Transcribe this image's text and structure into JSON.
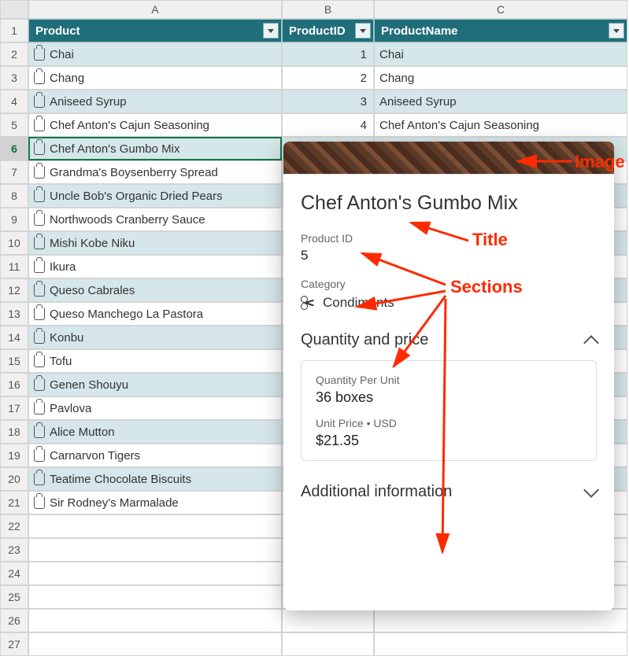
{
  "columns": {
    "a": "A",
    "b": "B",
    "c": "C"
  },
  "headers": {
    "product": "Product",
    "productId": "ProductID",
    "productName": "ProductName"
  },
  "rows": [
    {
      "n": 2,
      "product": "Chai",
      "id": "1",
      "name": "Chai",
      "band": true
    },
    {
      "n": 3,
      "product": "Chang",
      "id": "2",
      "name": "Chang",
      "band": false
    },
    {
      "n": 4,
      "product": "Aniseed Syrup",
      "id": "3",
      "name": "Aniseed Syrup",
      "band": true
    },
    {
      "n": 5,
      "product": "Chef Anton's Cajun Seasoning",
      "id": "4",
      "name": "Chef Anton's Cajun Seasoning",
      "band": false
    },
    {
      "n": 6,
      "product": "Chef Anton's Gumbo Mix",
      "id": "",
      "name": "",
      "band": true,
      "selected": true
    },
    {
      "n": 7,
      "product": "Grandma's Boysenberry Spread",
      "id": "",
      "name": "",
      "band": false
    },
    {
      "n": 8,
      "product": "Uncle Bob's Organic Dried Pears",
      "id": "",
      "name": "",
      "band": true
    },
    {
      "n": 9,
      "product": "Northwoods Cranberry Sauce",
      "id": "",
      "name": "",
      "band": false
    },
    {
      "n": 10,
      "product": "Mishi Kobe Niku",
      "id": "",
      "name": "",
      "band": true
    },
    {
      "n": 11,
      "product": "Ikura",
      "id": "",
      "name": "",
      "band": false
    },
    {
      "n": 12,
      "product": "Queso Cabrales",
      "id": "",
      "name": "",
      "band": true
    },
    {
      "n": 13,
      "product": "Queso Manchego La Pastora",
      "id": "",
      "name": "",
      "band": false
    },
    {
      "n": 14,
      "product": "Konbu",
      "id": "",
      "name": "",
      "band": true
    },
    {
      "n": 15,
      "product": "Tofu",
      "id": "",
      "name": "",
      "band": false
    },
    {
      "n": 16,
      "product": "Genen Shouyu",
      "id": "",
      "name": "",
      "band": true
    },
    {
      "n": 17,
      "product": "Pavlova",
      "id": "",
      "name": "",
      "band": false
    },
    {
      "n": 18,
      "product": "Alice Mutton",
      "id": "",
      "name": "",
      "band": true
    },
    {
      "n": 19,
      "product": "Carnarvon Tigers",
      "id": "",
      "name": "",
      "band": false
    },
    {
      "n": 20,
      "product": "Teatime Chocolate Biscuits",
      "id": "",
      "name": "",
      "band": true
    },
    {
      "n": 21,
      "product": "Sir Rodney's Marmalade",
      "id": "",
      "name": "",
      "band": false
    }
  ],
  "emptyRows": [
    22,
    23,
    24,
    25,
    26,
    27
  ],
  "card": {
    "title": "Chef Anton's Gumbo Mix",
    "productIdLabel": "Product ID",
    "productIdValue": "5",
    "categoryLabel": "Category",
    "categoryValue": "Condiments",
    "qp": {
      "header": "Quantity and price",
      "qpuLabel": "Quantity Per Unit",
      "qpuValue": "36 boxes",
      "upLabel": "Unit Price • USD",
      "upValue": "$21.35"
    },
    "additional": {
      "header": "Additional information"
    }
  },
  "annotations": {
    "image": "Image",
    "title": "Title",
    "sections": "Sections"
  }
}
